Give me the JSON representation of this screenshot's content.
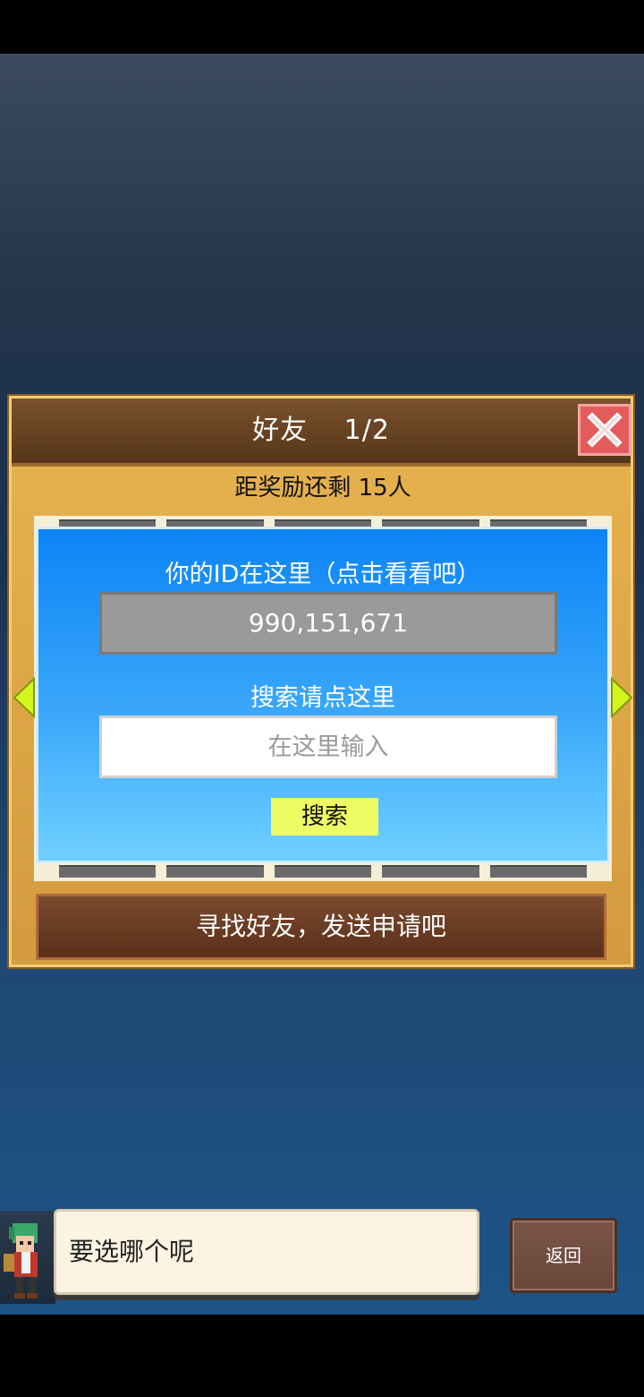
{
  "panel": {
    "title": "好友",
    "page": "1/2",
    "reward_text": "距奖励还剩 15人",
    "id_label": "你的ID在这里（点击看看吧）",
    "user_id": "990,151,671",
    "search_label": "搜索请点这里",
    "search_placeholder": "在这里输入",
    "search_button": "搜索",
    "find_button": "寻找好友，发送申请吧"
  },
  "dialog": {
    "text": "要选哪个呢",
    "back_button": "返回"
  },
  "icons": {
    "close": "close-icon",
    "prev": "arrow-left-icon",
    "next": "arrow-right-icon"
  },
  "colors": {
    "panel_gold": "#dca546",
    "header_brown": "#6a4524",
    "close_red": "#e35c5c",
    "blue_box": "#3aa7fa",
    "search_button_yellow": "#eefb62",
    "arrow_green": "#d4f51e"
  }
}
